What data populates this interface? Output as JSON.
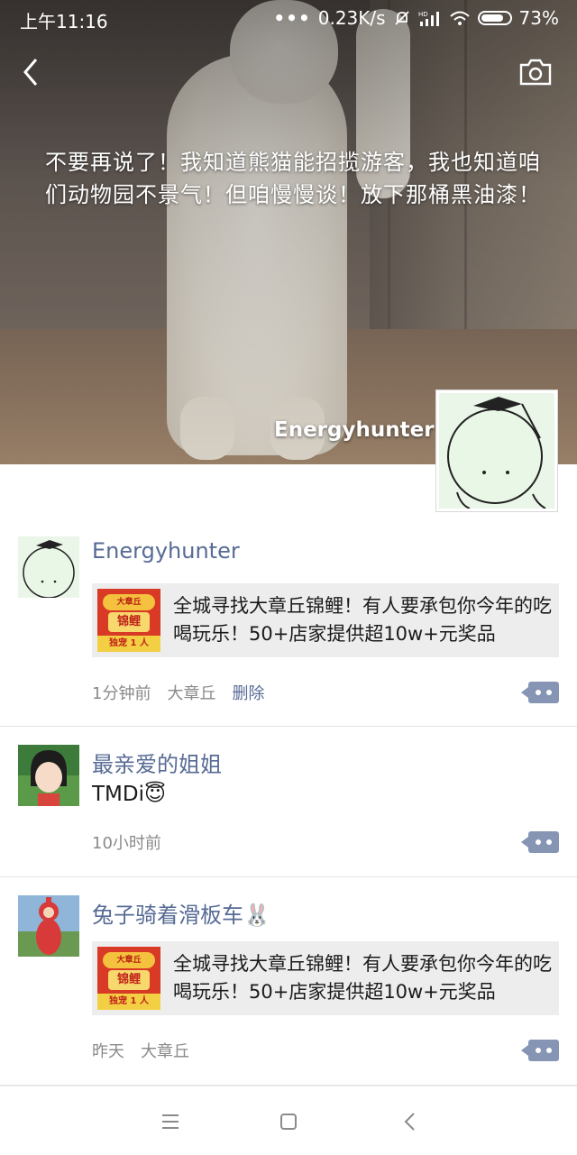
{
  "status_bar": {
    "time": "上午11:16",
    "dots": "•••",
    "speed": "0.23K/s",
    "battery": "73%",
    "icons": [
      "bell-off-icon",
      "hd-signal-icon",
      "wifi-icon",
      "battery-icon"
    ]
  },
  "header": {
    "back_icon": "chevron-left-icon",
    "camera_icon": "camera-icon"
  },
  "cover": {
    "caption": "不要再说了！我知道熊猫能招揽游客，我也知道咱们动物园不景气！但咱慢慢谈！放下那桶黑油漆！",
    "owner_name": "Energyhunter"
  },
  "posts": [
    {
      "user": "Energyhunter",
      "share": {
        "thumb_top": "大章丘",
        "thumb_mid": "锦鲤",
        "thumb_bottom": "独宠 1 人",
        "text": "全城寻找大章丘锦鲤！有人要承包你今年的吃喝玩乐！50+店家提供超10w+元奖品"
      },
      "time": "1分钟前",
      "location": "大章丘",
      "delete_label": "删除"
    },
    {
      "user": "最亲爱的姐姐",
      "text": "TMDi😇",
      "time": "10小时前"
    },
    {
      "user": "兔子骑着滑板车🐰",
      "share": {
        "thumb_top": "大章丘",
        "thumb_mid": "锦鲤",
        "thumb_bottom": "独宠 1 人",
        "text": "全城寻找大章丘锦鲤！有人要承包你今年的吃喝玩乐！50+店家提供超10w+元奖品"
      },
      "time": "昨天",
      "location": "大章丘"
    }
  ],
  "colors": {
    "link": "#576b95",
    "meta": "#8a8a8a",
    "comment_button": "#8595b3",
    "share_bg": "#ededed"
  },
  "system_nav": {
    "icons": [
      "menu-icon",
      "home-square-icon",
      "back-triangle-icon"
    ]
  }
}
